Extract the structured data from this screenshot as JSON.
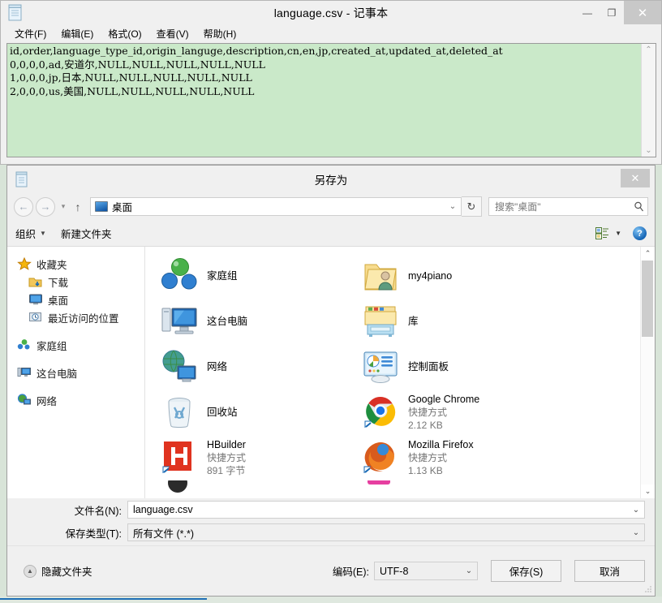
{
  "notepad": {
    "title": "language.csv - 记事本",
    "icon": "notepad-icon",
    "menu": [
      {
        "label": "文件(F)"
      },
      {
        "label": "编辑(E)"
      },
      {
        "label": "格式(O)"
      },
      {
        "label": "查看(V)"
      },
      {
        "label": "帮助(H)"
      }
    ],
    "window_controls": {
      "minimize": "—",
      "maximize": "❐",
      "close": "✕"
    },
    "content": "id,order,language_type_id,origin_languge,description,cn,en,jp,created_at,updated_at,deleted_at\n0,0,0,0,ad,安道尔,NULL,NULL,NULL,NULL,NULL\n1,0,0,0,jp,日本,NULL,NULL,NULL,NULL,NULL\n2,0,0,0,us,美国,NULL,NULL,NULL,NULL,NULL",
    "scroll_up": "⌃",
    "scroll_down": "⌄",
    "bg_color": "#cae9c9"
  },
  "dialog": {
    "title": "另存为",
    "close_label": "✕",
    "nav": {
      "back": "←",
      "forward": "→",
      "history_caret": "▾",
      "up": "↑",
      "address_value": "桌面",
      "address_dropdown": "⌄",
      "refresh": "↻"
    },
    "search": {
      "placeholder": "搜索\"桌面\"",
      "icon": "search-icon"
    },
    "commandbar": {
      "organize": "组织",
      "organize_caret": "▼",
      "new_folder": "新建文件夹",
      "view_caret": "▼",
      "help": "?"
    },
    "navpane": [
      {
        "label": "收藏夹",
        "icon": "star-icon",
        "sub": false
      },
      {
        "label": "下载",
        "icon": "downloads-folder-icon",
        "sub": true
      },
      {
        "label": "桌面",
        "icon": "desktop-monitor-icon",
        "sub": true
      },
      {
        "label": "最近访问的位置",
        "icon": "recent-places-icon",
        "sub": true
      },
      {
        "label": "家庭组",
        "icon": "homegroup-icon",
        "sub": false
      },
      {
        "label": "这台电脑",
        "icon": "this-pc-icon",
        "sub": false
      },
      {
        "label": "网络",
        "icon": "network-icon",
        "sub": false
      }
    ],
    "files": [
      {
        "name": "家庭组",
        "type": "",
        "size": "",
        "icon": "homegroup-icon"
      },
      {
        "name": "my4piano",
        "type": "",
        "size": "",
        "icon": "user-folder-icon"
      },
      {
        "name": "这台电脑",
        "type": "",
        "size": "",
        "icon": "this-pc-icon"
      },
      {
        "name": "库",
        "type": "",
        "size": "",
        "icon": "libraries-icon"
      },
      {
        "name": "网络",
        "type": "",
        "size": "",
        "icon": "network-icon"
      },
      {
        "name": "控制面板",
        "type": "",
        "size": "",
        "icon": "control-panel-icon"
      },
      {
        "name": "回收站",
        "type": "",
        "size": "",
        "icon": "recycle-bin-icon"
      },
      {
        "name": "Google Chrome",
        "type": "快捷方式",
        "size": "2.12 KB",
        "icon": "chrome-icon"
      },
      {
        "name": "HBuilder",
        "type": "快捷方式",
        "size": "891 字节",
        "icon": "hbuilder-icon"
      },
      {
        "name": "Mozilla Firefox",
        "type": "快捷方式",
        "size": "1.13 KB",
        "icon": "firefox-icon"
      }
    ],
    "scrollbar": {
      "up": "⌃",
      "down": "⌄"
    },
    "form": {
      "filename_label": "文件名(N):",
      "filename_value": "language.csv",
      "filetype_label": "保存类型(T):",
      "filetype_value": "所有文件  (*.*)",
      "dropdown_caret": "⌄"
    },
    "footer": {
      "hide_folders": "隐藏文件夹",
      "hide_folders_caret": "▲",
      "encoding_label": "编码(E):",
      "encoding_value": "UTF-8",
      "encoding_caret": "⌄",
      "save_button": "保存(S)",
      "cancel_button": "取消"
    }
  }
}
